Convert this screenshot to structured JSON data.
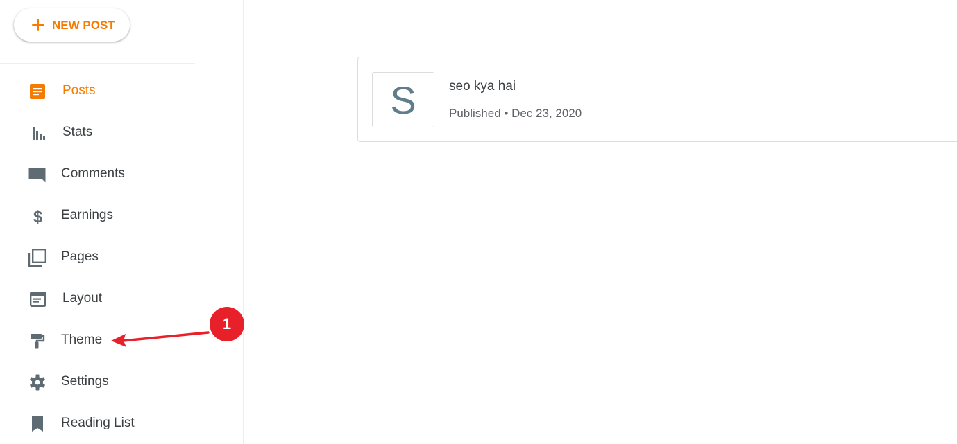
{
  "sidebar": {
    "new_post_label": "NEW POST",
    "items": [
      {
        "label": "Posts",
        "icon": "posts-icon",
        "active": true
      },
      {
        "label": "Stats",
        "icon": "stats-icon"
      },
      {
        "label": "Comments",
        "icon": "comments-icon"
      },
      {
        "label": "Earnings",
        "icon": "earnings-icon"
      },
      {
        "label": "Pages",
        "icon": "pages-icon"
      },
      {
        "label": "Layout",
        "icon": "layout-icon"
      },
      {
        "label": "Theme",
        "icon": "theme-icon"
      },
      {
        "label": "Settings",
        "icon": "settings-icon"
      },
      {
        "label": "Reading List",
        "icon": "reading-list-icon"
      }
    ]
  },
  "posts": [
    {
      "thumb_letter": "S",
      "title": "seo kya hai",
      "status": "Published",
      "separator": " • ",
      "date": "Dec 23, 2020"
    }
  ],
  "annotation": {
    "badge_number": "1"
  },
  "colors": {
    "accent": "#f57c00",
    "icon_gray": "#5f6b73",
    "badge_red": "#e8202a"
  }
}
